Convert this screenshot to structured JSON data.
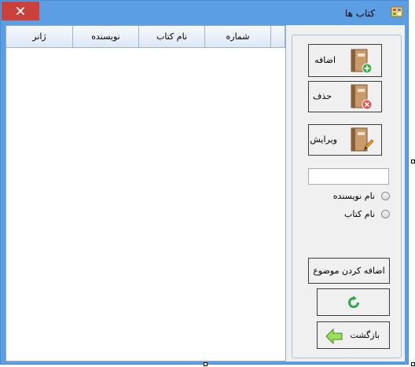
{
  "window": {
    "title": "کتاب ها",
    "close_glyph": "✕"
  },
  "grid": {
    "columns": [
      "شماره",
      "نام کتاب",
      "نویسنده",
      "ژانر"
    ]
  },
  "buttons": {
    "add_label": "اضافه",
    "delete_label": "حذف",
    "edit_label": "ویرایش",
    "add_topic_label": "اضافه کردن موضوع",
    "back_label": "بازگشت"
  },
  "search": {
    "value": ""
  },
  "radios": {
    "author_label": "نام نویسنده",
    "book_label": "نام کتاب"
  },
  "colors": {
    "titlebar": "#5b9ee3",
    "close": "#c9413a",
    "accent_green": "#3cb043",
    "delete_red": "#e35050"
  }
}
